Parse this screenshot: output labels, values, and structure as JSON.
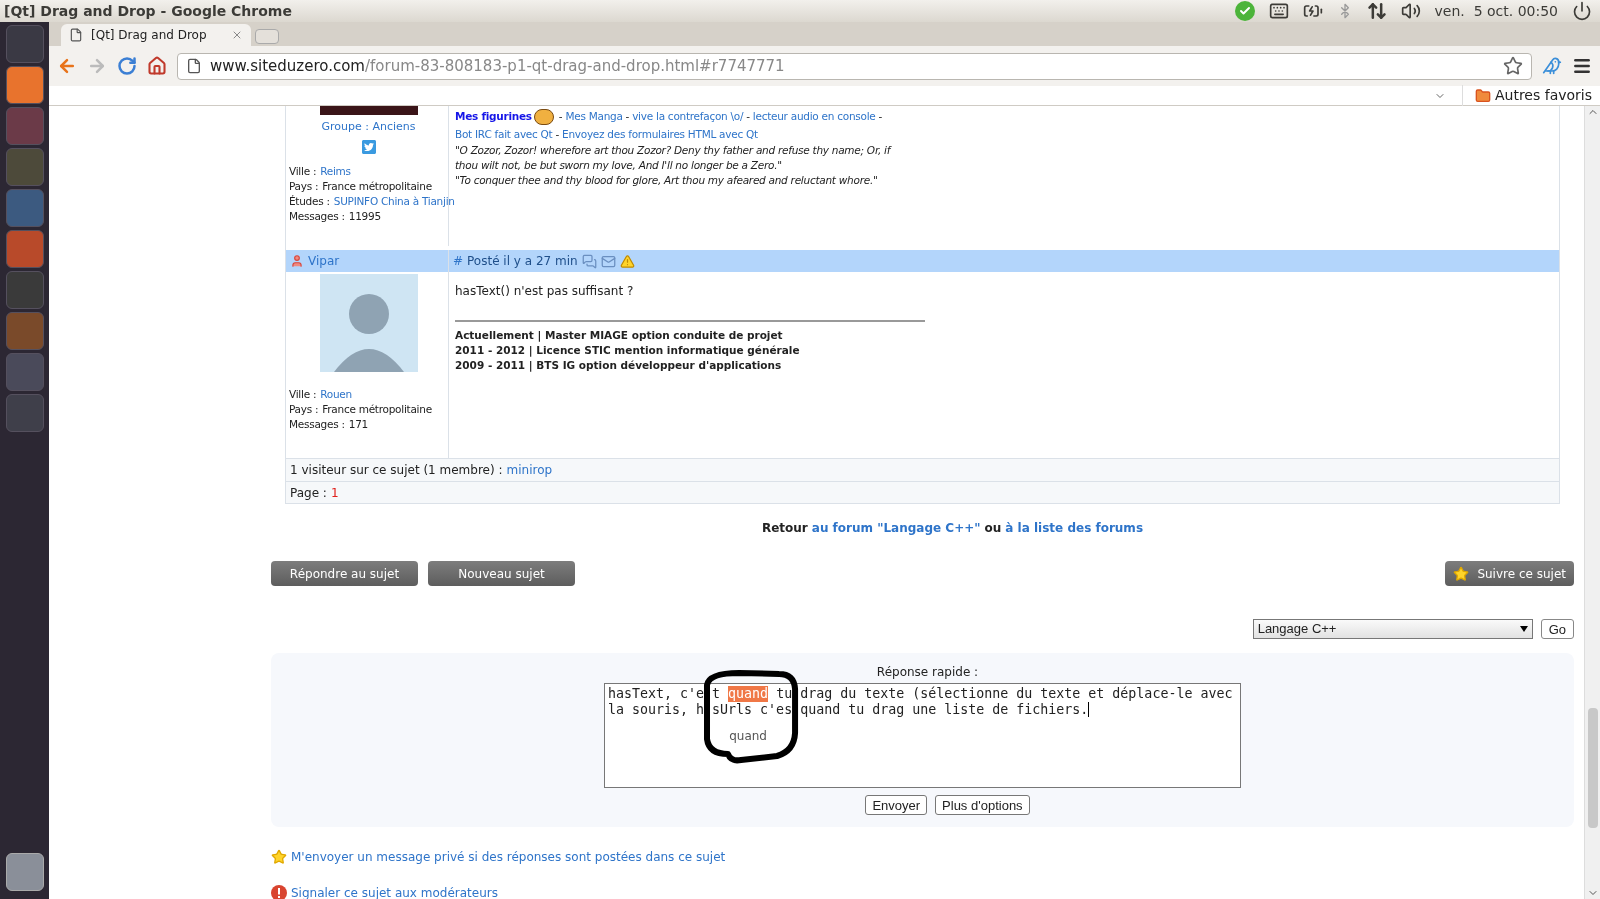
{
  "window": {
    "title": "[Qt] Drag and Drop - Google Chrome"
  },
  "top_panel": {
    "clock": "ven.  5 oct. 00:50"
  },
  "browser": {
    "tabs": [
      {
        "label": "[Qt] Drag and Drop",
        "selected": true
      }
    ],
    "url_host": "www.siteduzero.com",
    "url_path": "/forum-83-808183-p1-qt-drag-and-drop.html#r7747771",
    "bookmarks": [
      "Autres favoris"
    ]
  },
  "first_post": {
    "group": "Groupe : Anciens",
    "details": [
      {
        "label": "Ville :",
        "value": "Reims",
        "link": true
      },
      {
        "label": "Pays :",
        "value": "France métropolitaine",
        "link": false
      },
      {
        "label": "Études :",
        "value": "SUPINFO China à Tianjin",
        "link": true
      },
      {
        "label": "Messages :",
        "value": "11995",
        "link": false
      }
    ],
    "signature_title": "Mes figurines",
    "separator": "-",
    "signature_links": [
      "Mes Manga",
      "vive la contrefaçon \\o/",
      "lecteur audio en console",
      "Bot IRC fait avec Qt",
      "Envoyez des formulaires HTML avec Qt"
    ],
    "quotes": [
      "\"O Zozor, Zozor! wherefore art thou Zozor? Deny thy father and refuse thy name; Or, if thou wilt not, be but sworn my love, And I'll no longer be a Zero.\"",
      "\"To conquer thee and thy blood for glore, Art thou my afeared and reluctant whore.\""
    ]
  },
  "second_post": {
    "author": "Vipar",
    "anchor": "#",
    "posted": "Posté il y a 27 min",
    "body": "hasText() n'est pas suffisant ?",
    "signature": [
      "Actuellement | Master MIAGE option conduite de projet",
      "2011 - 2012 | Licence STIC mention informatique générale",
      "2009 - 2011 | BTS IG option développeur d'applications"
    ],
    "details": [
      {
        "label": "Ville :",
        "value": "Rouen",
        "link": true
      },
      {
        "label": "Pays :",
        "value": "France métropolitaine",
        "link": false
      },
      {
        "label": "Messages :",
        "value": "171",
        "link": false
      }
    ]
  },
  "visitors": {
    "text": "1 visiteur sur ce sujet (1 membre) :",
    "members": [
      "minirop"
    ]
  },
  "pagination": {
    "label": "Page :",
    "pages": [
      {
        "label": "1",
        "selected": true
      }
    ]
  },
  "back": {
    "prefix": "Retour",
    "first_link": "au forum \"Langage C++\"",
    "joiner": "ou",
    "second_link": "à la liste des forums"
  },
  "actions": [
    "Répondre au sujet",
    "Nouveau sujet"
  ],
  "follow": "Suivre ce sujet",
  "forum_jump": {
    "value": "Langage C++",
    "button": "Go"
  },
  "quick_reply": {
    "title": "Réponse rapide :",
    "lines": [
      {
        "fragments": [
          {
            "text": "hasText, c'e",
            "selected": false
          },
          {
            "text": "t",
            "selected": false
          },
          {
            "text": "quand",
            "selected": true
          },
          {
            "text": "tu",
            "selected": false
          },
          {
            "text": "drag du texte (sélectionne du texte et déplace-le avec",
            "selected": false
          }
        ]
      },
      {
        "fragments": [
          {
            "text": "la souris, h",
            "selected": false
          },
          {
            "text": "sUrls c'es",
            "selected": false
          },
          {
            "text": "quand tu drag une liste de fichiers.",
            "selected": false
          }
        ]
      }
    ],
    "drag_ghost": "quand",
    "buttons": [
      "Envoyer",
      "Plus d'options"
    ]
  },
  "footer_links": [
    {
      "kind": "star",
      "label": "M'envoyer un message privé si des réponses sont postées dans ce sujet"
    },
    {
      "kind": "alert",
      "label": "Signaler ce sujet aux modérateurs"
    }
  ]
}
